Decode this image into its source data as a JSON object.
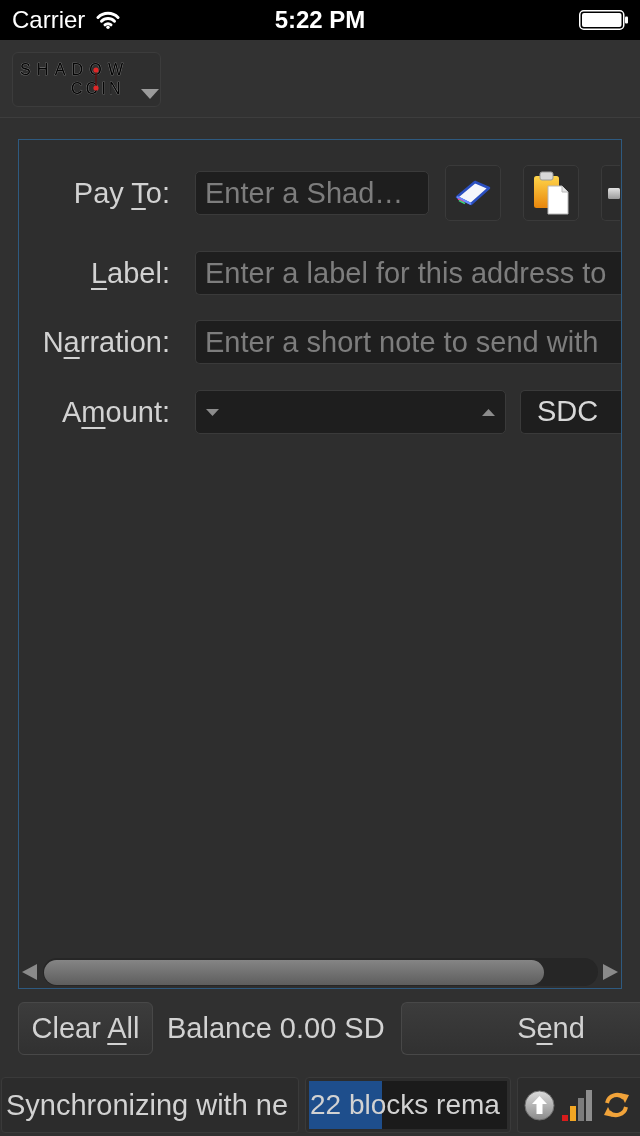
{
  "status_bar": {
    "carrier": "Carrier",
    "time": "5:22 PM"
  },
  "toolbar": {
    "logo": {
      "line_1": "SHADOW",
      "line_2": "COIN"
    }
  },
  "send_form": {
    "rows": [
      {
        "kind": "address",
        "label": [
          {
            "text": "Pay ",
            "underline": false
          },
          {
            "text": "T",
            "underline": true
          },
          {
            "text": "o:",
            "underline": false
          }
        ],
        "placeholder": "Enter a Shad…"
      },
      {
        "kind": "text",
        "label": [
          {
            "text": "L",
            "underline": true
          },
          {
            "text": "abel:",
            "underline": false
          }
        ],
        "placeholder": "Enter a label for this address to"
      },
      {
        "kind": "text",
        "label": [
          {
            "text": "N",
            "underline": false
          },
          {
            "text": "a",
            "underline": true
          },
          {
            "text": "rration:",
            "underline": false
          }
        ],
        "placeholder": "Enter a short note to send with"
      },
      {
        "kind": "amount",
        "label": [
          {
            "text": "A",
            "underline": false
          },
          {
            "text": "m",
            "underline": true
          },
          {
            "text": "ount:",
            "underline": false
          }
        ],
        "unit": "SDC"
      }
    ]
  },
  "actions": {
    "clear_all": {
      "label": [
        {
          "text": "Clear ",
          "underline": false
        },
        {
          "text": "A",
          "underline": true
        },
        {
          "text": "ll",
          "underline": false
        }
      ]
    },
    "balance": {
      "label": "Balance",
      "value": "0.00 SD"
    },
    "send": {
      "label": [
        {
          "text": "S",
          "underline": false
        },
        {
          "text": "e",
          "underline": true
        },
        {
          "text": "nd",
          "underline": false
        }
      ]
    }
  },
  "footer": {
    "status_text": "Synchronizing with ne",
    "progress": {
      "text": "22 blocks rema",
      "level": 0.37
    }
  }
}
